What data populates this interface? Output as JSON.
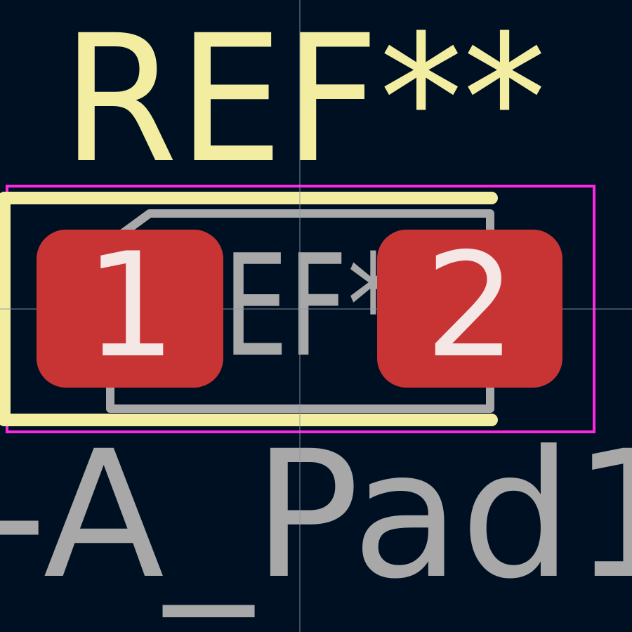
{
  "colors": {
    "background": "#001023",
    "silkscreen": "#f2eda1",
    "fab": "#a8a8a8",
    "courtyard": "#ff26e2",
    "pad": "#c83434",
    "pad_label": "#f6e7e7",
    "crosshair": "#8d96a3"
  },
  "footprint": {
    "reference": "REF**",
    "value_fragment": "-A_Pad1",
    "fab_reference_fragment": "EF*",
    "pads": [
      {
        "number": "1"
      },
      {
        "number": "2"
      }
    ]
  },
  "icons": {
    "crosshair": "crosshair-icon"
  }
}
